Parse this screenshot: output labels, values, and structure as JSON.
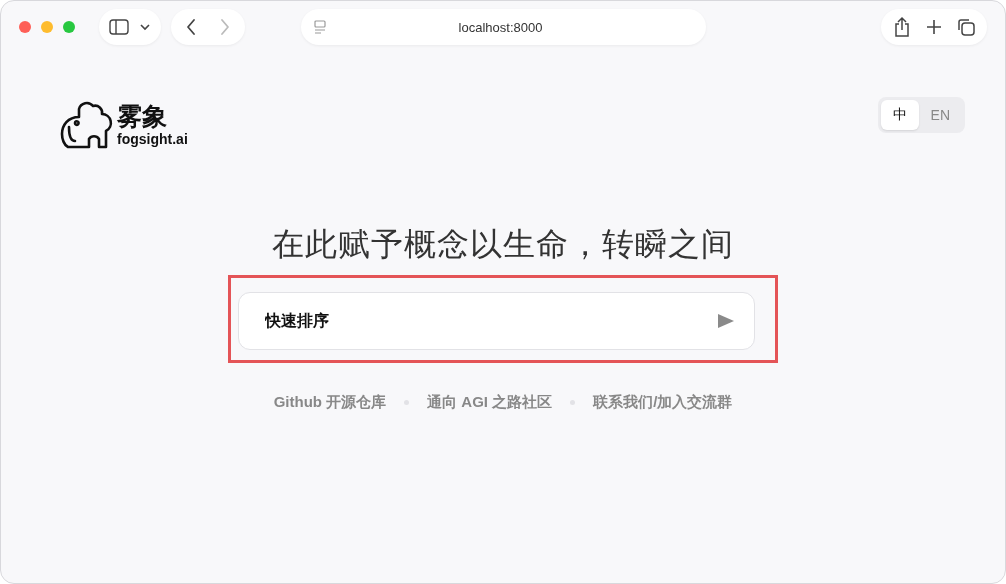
{
  "browser": {
    "address": "localhost:8000",
    "nav": [
      {
        "kind": "back",
        "disabled": false
      },
      {
        "kind": "forward",
        "disabled": true
      }
    ]
  },
  "logo": {
    "name": "雾象",
    "domain": "fogsight.ai"
  },
  "language_toggle": [
    {
      "label": "中",
      "selected": true
    },
    {
      "label": "EN",
      "selected": false
    }
  ],
  "headline": "在此赋予概念以生命，转瞬之间",
  "prompt": {
    "value": "快速排序",
    "highlighted": true
  },
  "links": [
    "Github 开源仓库",
    "通向 AGI 之路社区",
    "联系我们/加入交流群"
  ]
}
